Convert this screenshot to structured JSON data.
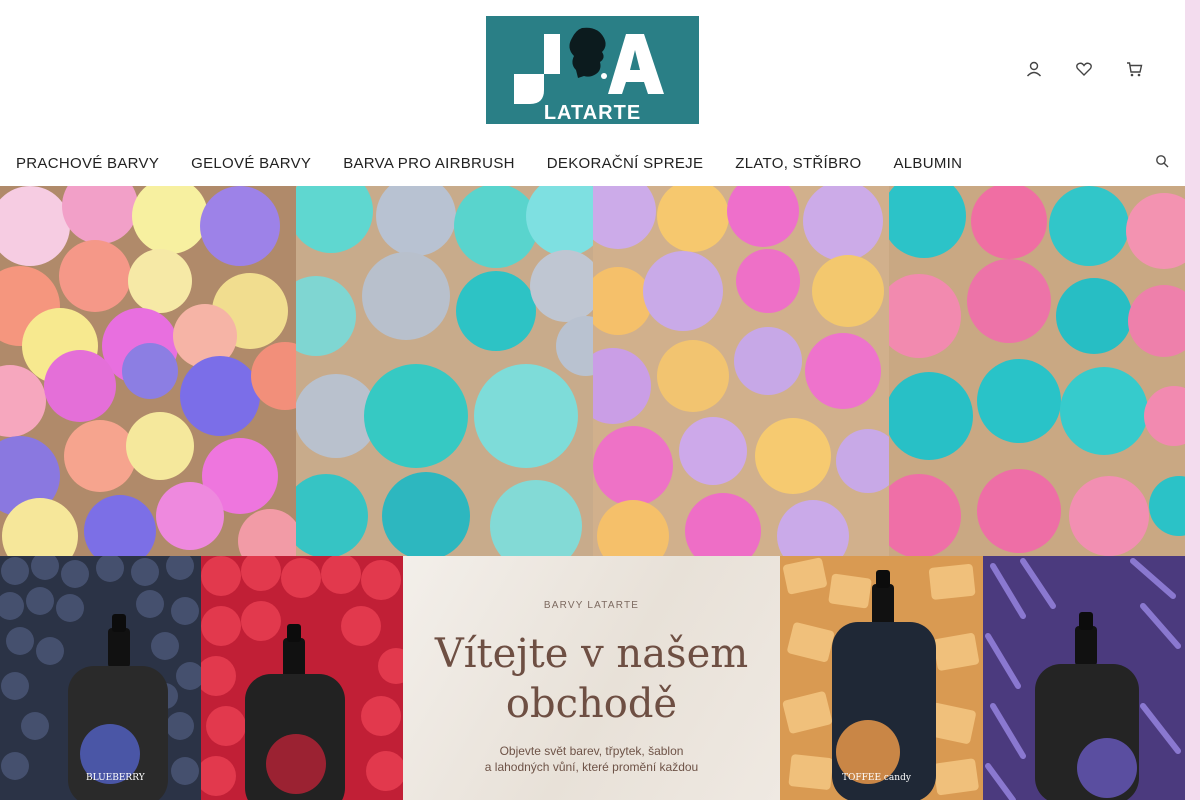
{
  "brand": {
    "logo_text": "LATARTE",
    "logo_letters": "JA",
    "logo_color": "#2a7f86"
  },
  "header_icons": [
    "user-icon",
    "heart-icon",
    "cart-icon"
  ],
  "nav": {
    "items": [
      {
        "label": "PRACHOVÉ BARVY"
      },
      {
        "label": "GELOVÉ BARVY"
      },
      {
        "label": "BARVA PRO AIRBRUSH"
      },
      {
        "label": "DEKORAČNÍ SPREJE"
      },
      {
        "label": "ZLATO, STŘÍBRO"
      },
      {
        "label": "ALBUMIN"
      }
    ],
    "search_icon": "search-icon"
  },
  "hero": {
    "panels": [
      "macarons-pastel",
      "macarons-turquoise-grey",
      "macarons-pink-purple-yellow",
      "macarons-pink-turquoise"
    ]
  },
  "promo": {
    "kicker": "BARVY LATARTE",
    "title_line1": "Vítejte v našem",
    "title_line2": "obchodě",
    "subtitle_line1": "Objevte svět barev, třpytek, šablon",
    "subtitle_line2": "a lahodných vůní, které promění každou"
  },
  "products": {
    "left": [
      "blueberry-bottle",
      "raspberry-bottle"
    ],
    "right": [
      "toffee-bottle",
      "lavender-bottle"
    ],
    "label_blueberry": "BLUEBERRY",
    "label_toffee": "TOFFEE candy"
  },
  "accent": {
    "scrollbar": "#f3dcee"
  }
}
